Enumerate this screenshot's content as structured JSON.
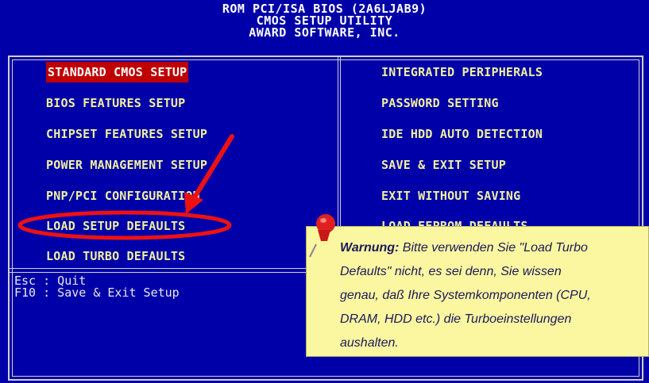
{
  "header": {
    "line1": "ROM PCI/ISA BIOS (2A6LJAB9)",
    "line2": "CMOS SETUP UTILITY",
    "line3": "AWARD SOFTWARE, INC."
  },
  "menu_left": [
    "STANDARD CMOS SETUP",
    "BIOS FEATURES SETUP",
    "CHIPSET FEATURES SETUP",
    "POWER MANAGEMENT SETUP",
    "PNP/PCI CONFIGURATION",
    "LOAD SETUP DEFAULTS",
    "LOAD TURBO DEFAULTS"
  ],
  "menu_right": [
    "INTEGRATED PERIPHERALS",
    "PASSWORD SETTING",
    "IDE HDD AUTO DETECTION",
    "SAVE & EXIT SETUP",
    "EXIT WITHOUT SAVING",
    "LOAD EEPROM DEFAULTS"
  ],
  "selected_item": "STANDARD CMOS SETUP",
  "help": {
    "esc": "Esc : Quit",
    "f10": "F10 : Save & Exit Setup"
  },
  "note": {
    "title": "Warnung:",
    "line1": " Bitte verwenden Sie \"Load Turbo",
    "line2": "Defaults\" nicht, es sei denn, Sie wissen",
    "line3": "genau, daß Ihre Systemkomponenten (CPU,",
    "line4": "DRAM, HDD etc.) die Turboeinstellungen",
    "line5": "aushalten."
  },
  "colors": {
    "background": "#0000a8",
    "menu_text": "#f0f0a0",
    "selection": "#c00000",
    "annotation": "#ee1111",
    "note_bg": "#fbf6a0"
  },
  "icons": [
    "push-pin-icon",
    "red-arrow-annotation",
    "red-ellipse-annotation"
  ]
}
